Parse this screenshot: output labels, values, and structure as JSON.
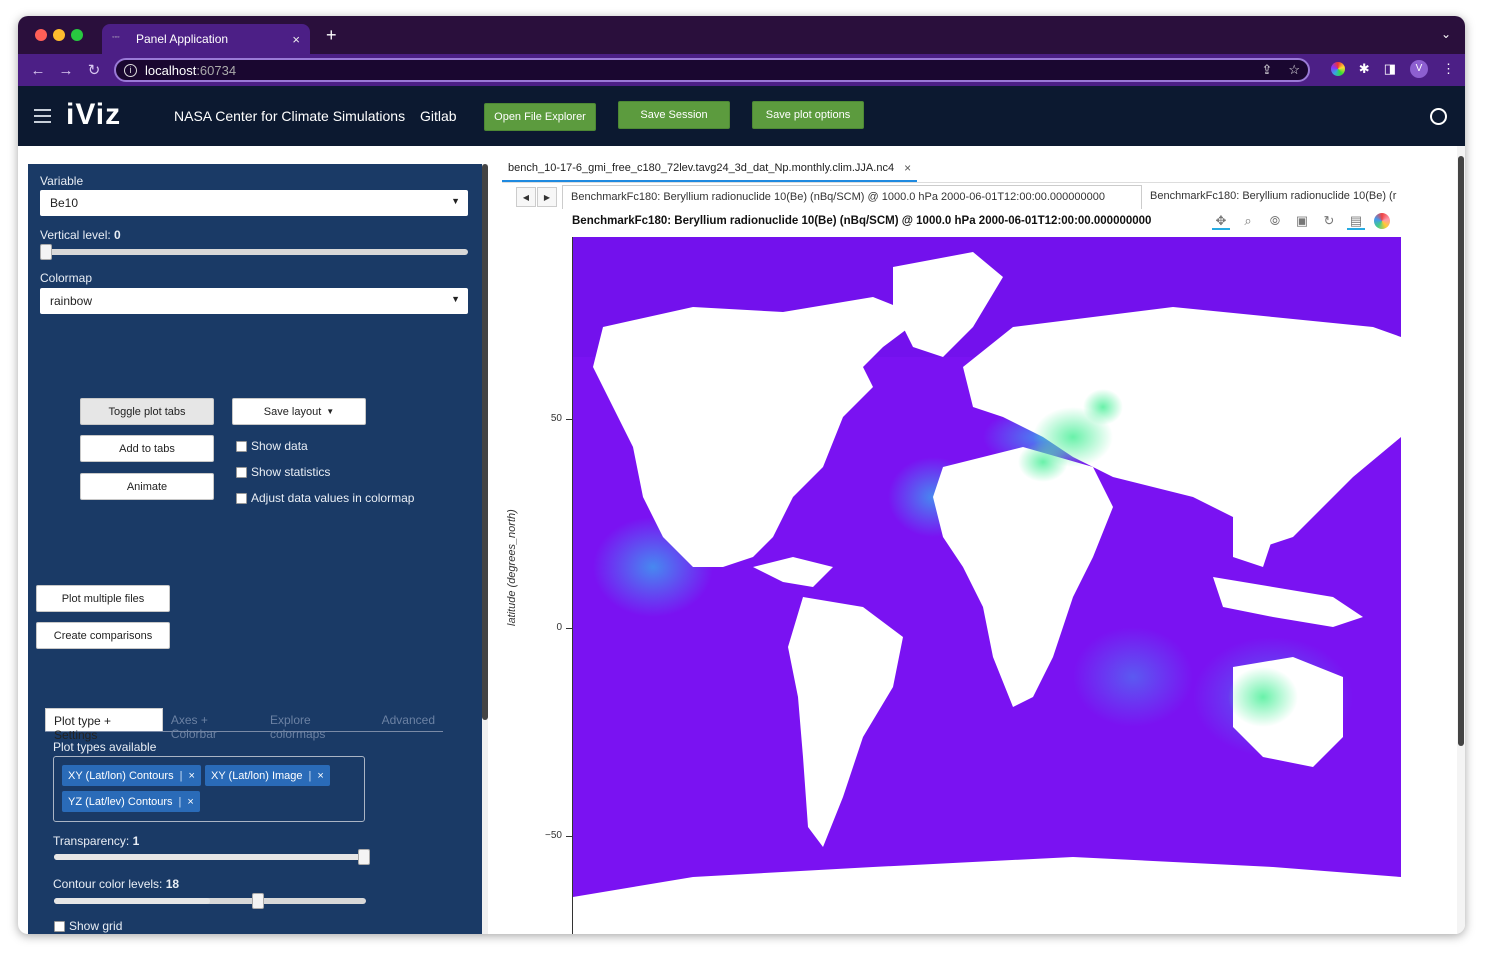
{
  "browser": {
    "tab_title": "Panel Application",
    "tab_close": "×",
    "new_tab": "+",
    "url_host": "localhost",
    "url_port": ":60734",
    "profile_initial": "V"
  },
  "header": {
    "app_name": "iViz",
    "link_nccs": "NASA Center for Climate Simulations",
    "link_gitlab": "Gitlab",
    "btn_open_file_explorer": "Open File Explorer",
    "btn_save_session": "Save Session",
    "btn_save_plot_options": "Save plot options",
    "accent_color": "#5c9b3e"
  },
  "sidebar": {
    "variable_label": "Variable",
    "variable_value": "Be10",
    "vertical_level_label": "Vertical level: ",
    "vertical_level_value": "0",
    "colormap_label": "Colormap",
    "colormap_value": "rainbow",
    "btn_toggle_plot_tabs": "Toggle plot tabs",
    "btn_add_to_tabs": "Add to tabs",
    "btn_animate": "Animate",
    "btn_save_layout": "Save layout",
    "chk_show_data": "Show data",
    "chk_show_statistics": "Show statistics",
    "chk_adjust_data": "Adjust data values in colormap",
    "btn_plot_multiple_files": "Plot multiple files",
    "btn_create_comparisons": "Create comparisons",
    "subtabs": [
      "Plot type + Settings",
      "Axes + Colorbar",
      "Explore colormaps",
      "Advanced"
    ],
    "plot_types_label": "Plot types available",
    "plot_types": [
      "XY (Lat/lon) Contours",
      "XY (Lat/lon) Image",
      "YZ (Lat/lev) Contours"
    ],
    "chip_remove": "×",
    "transparency_label": "Transparency: ",
    "transparency_value": "1",
    "contour_levels_label": "Contour color levels: ",
    "contour_levels_value": "18",
    "contour_levels_fraction": 0.5,
    "chk_show_grid": "Show grid",
    "panel_color": "#1a3a66"
  },
  "main": {
    "file_tab": "bench_10-17-6_gmi_free_c180_72lev.tavg24_3d_dat_Np.monthly.clim.JJA.nc4",
    "file_tab_close": "×",
    "plot_tab_1": "BenchmarkFc180: Beryllium radionuclide 10(Be) (nBq/SCM) @ 1000.0 hPa 2000-06-01T12:00:00.000000000",
    "plot_tab_2": "BenchmarkFc180: Beryllium radionuclide 10(Be) (r",
    "plot_title": "BenchmarkFc180: Beryllium radionuclide 10(Be) (nBq/SCM) @ 1000.0 hPa 2000-06-01T12:00:00.000000000",
    "y_axis_label": "latitude (degrees_north)",
    "y_ticks": [
      "50",
      "0",
      "−50"
    ],
    "ocean_color": "#7a12f2",
    "land_color": "#ffffff"
  }
}
